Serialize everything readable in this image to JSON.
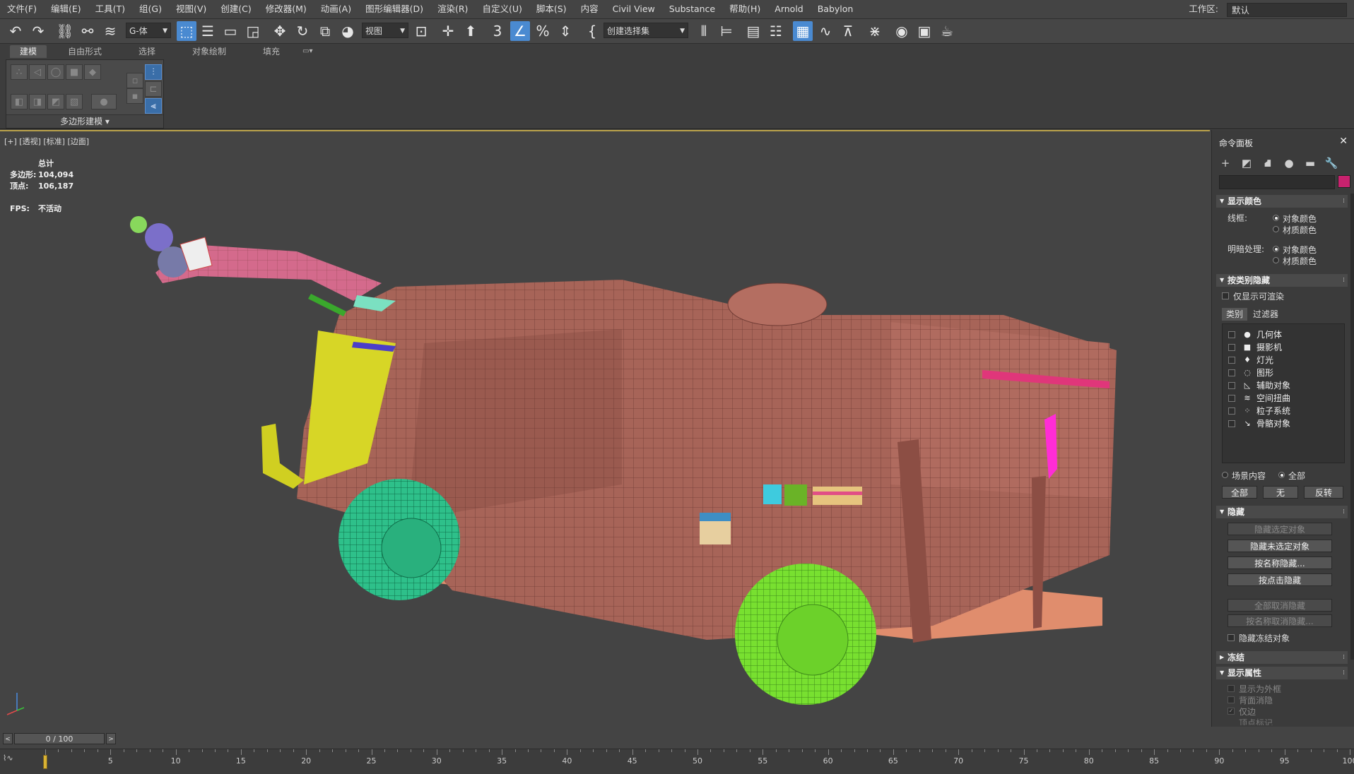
{
  "menu": [
    "文件(F)",
    "编辑(E)",
    "工具(T)",
    "组(G)",
    "视图(V)",
    "创建(C)",
    "修改器(M)",
    "动画(A)",
    "图形编辑器(D)",
    "渲染(R)",
    "自定义(U)",
    "脚本(S)",
    "内容",
    "Civil View",
    "Substance",
    "帮助(H)",
    "Arnold",
    "Babylon"
  ],
  "workspace": {
    "label": "工作区:",
    "value": "默认"
  },
  "toolbar": {
    "filter_select": "G-体",
    "ref_coord_select": "视图",
    "named_selection_select": "创建选择集"
  },
  "ribbon": {
    "tabs": [
      "建模",
      "自由形式",
      "选择",
      "对象绘制",
      "填充"
    ],
    "active_tab": "建模",
    "panel_label": "多边形建模 ▾"
  },
  "viewport": {
    "label": "[+] [透视] [标准] [边面]",
    "stats": {
      "header": "总计",
      "polys_label": "多边形:",
      "polys_value": "104,094",
      "verts_label": "顶点:",
      "verts_value": "106,187",
      "fps_label": "FPS:",
      "fps_value": "不活动"
    }
  },
  "command_panel": {
    "title": "命令面板",
    "swatch_color": "#c8226e",
    "display_color": {
      "title": "显示颜色",
      "wireframe_label": "线框:",
      "shaded_label": "明暗处理:",
      "opt_object": "对象颜色",
      "opt_material": "材质颜色"
    },
    "hide_by_category": {
      "title": "按类别隐藏",
      "renderable_only": "仅显示可渲染",
      "tabs": [
        "类别",
        "过滤器"
      ],
      "items": [
        {
          "label": "几何体",
          "icon": "●"
        },
        {
          "label": "摄影机",
          "icon": "■"
        },
        {
          "label": "灯光",
          "icon": "♦"
        },
        {
          "label": "图形",
          "icon": "◌"
        },
        {
          "label": "辅助对象",
          "icon": "◺"
        },
        {
          "label": "空间扭曲",
          "icon": "≋"
        },
        {
          "label": "粒子系统",
          "icon": "⁘"
        },
        {
          "label": "骨骼对象",
          "icon": "↘"
        }
      ],
      "scope_scene": "场景内容",
      "scope_all": "全部",
      "btn_all": "全部",
      "btn_none": "无",
      "btn_invert": "反转"
    },
    "hide": {
      "title": "隐藏",
      "buttons": [
        "隐藏选定对象",
        "隐藏未选定对象",
        "按名称隐藏...",
        "按点击隐藏",
        "全部取消隐藏",
        "按名称取消隐藏...",
        "隐藏冻结对象"
      ]
    },
    "freeze": {
      "title": "冻结"
    },
    "display_props": {
      "title": "显示属性",
      "items": [
        "显示为外框",
        "背面消隐",
        "仅边",
        "顶点标记"
      ]
    }
  },
  "timeline": {
    "frame_value": "0 / 100",
    "start": 0,
    "end": 100,
    "current": 0,
    "label_step": 5
  }
}
